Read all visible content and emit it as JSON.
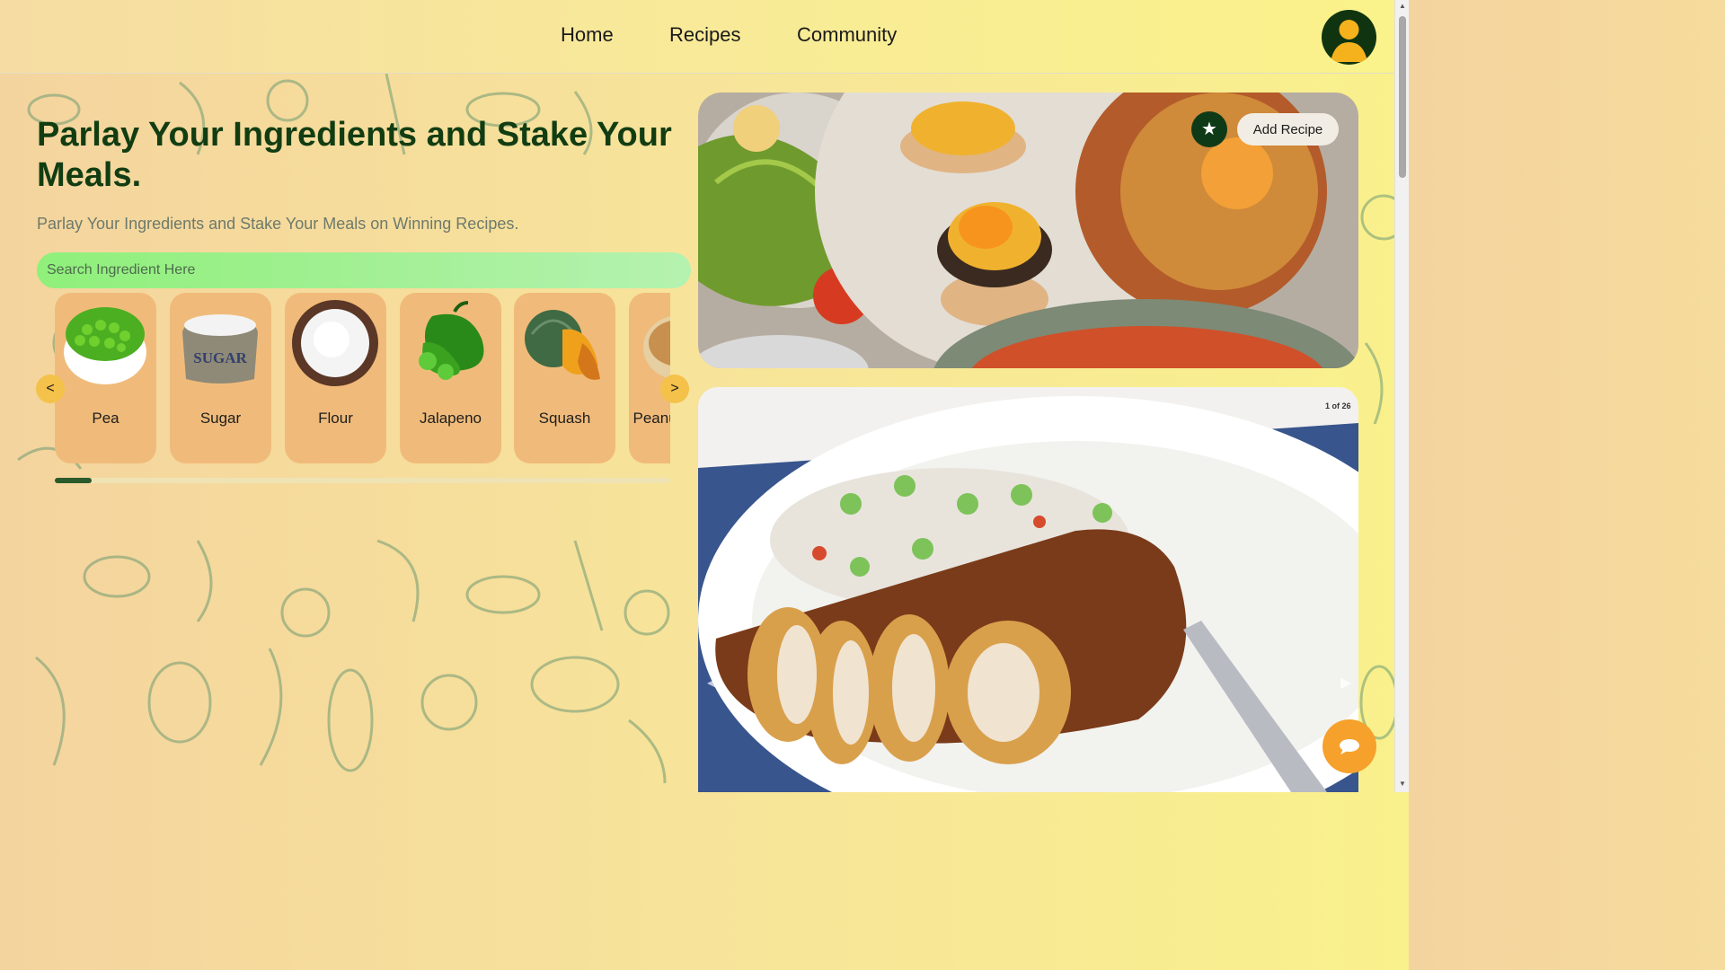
{
  "nav": {
    "home": "Home",
    "recipes": "Recipes",
    "community": "Community"
  },
  "hero": {
    "title": "Parlay Your Ingredients and Stake Your Meals.",
    "subtitle": "Parlay Your Ingredients and Stake Your Meals on Winning Recipes."
  },
  "search": {
    "placeholder": "Search Ingredient Here"
  },
  "ingredients": [
    {
      "label": "Pea",
      "icon": "pea-bowl-icon"
    },
    {
      "label": "Sugar",
      "icon": "sugar-sack-icon"
    },
    {
      "label": "Flour",
      "icon": "flour-bowl-icon"
    },
    {
      "label": "Jalapeno",
      "icon": "jalapeno-icon"
    },
    {
      "label": "Squash",
      "icon": "squash-icon"
    },
    {
      "label": "Peanut Butter",
      "icon": "peanut-butter-icon"
    }
  ],
  "carousel": {
    "prev": "<",
    "next": ">",
    "progress": 0.06
  },
  "featured": {
    "add_recipe": "Add Recipe",
    "star": "★",
    "slide_count": "1 of 26",
    "prev": "◀",
    "next": "▶"
  },
  "colors": {
    "accent_green": "#123d12",
    "search_green": "#8ff07a",
    "card_orange": "#f0bb7a",
    "chat_orange": "#f6a12c"
  }
}
